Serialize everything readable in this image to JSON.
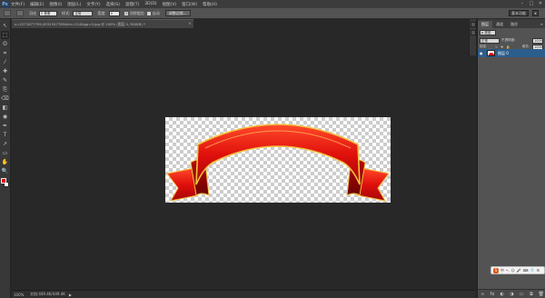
{
  "menubar": {
    "logo": "Ps",
    "items": [
      "文件(F)",
      "编辑(E)",
      "图像(I)",
      "图层(L)",
      "文字(Y)",
      "选择(S)",
      "滤镜(T)",
      "3D(D)",
      "视图(V)",
      "窗口(W)",
      "帮助(H)"
    ],
    "window_buttons": [
      "–",
      "□",
      "✕"
    ]
  },
  "options": {
    "feather_label": "羽化",
    "feather_value": "0 像素",
    "mode_label": "样式:",
    "mode_value": "正常",
    "width_label": "宽度:",
    "width_value": "0",
    "antialias_label": "消除锯齿",
    "antialias_checked": "✓",
    "auto_label": "自动",
    "refine_label": "调整边缘...",
    "workspace": "基本功能"
  },
  "document": {
    "tab_title": "u=2271877799,4531347765&fm=214&gp=0.jpg @ 100% (图层 0, RGB/8) *",
    "close": "×",
    "zoom": "100%",
    "doc_info": "文档:449.4K/449.4K",
    "status_arrow": "▶"
  },
  "tools": [
    "↖",
    "⬚",
    "ʘ",
    "⌗",
    "⁄",
    "✚",
    "✎",
    "⎘",
    "⌫",
    "◧",
    "◉",
    "✒",
    "T",
    "↗",
    "▭",
    "✋",
    "🔍"
  ],
  "panel": {
    "tabs": [
      "图层",
      "通道",
      "路径"
    ],
    "menu": "≡",
    "kind_label": "ρ 类型",
    "blend_mode": "正常",
    "opacity_label": "不透明度:",
    "opacity_value": "100%",
    "lock_label": "锁定:",
    "lock_icons": "⬚ ✎ ✚ 🔒",
    "fill_label": "填充:",
    "fill_value": "100%",
    "layer_name": "图层 0",
    "layer_visible": "●",
    "footer_icons": [
      "∞",
      "fx",
      "◐",
      "◑",
      "▭",
      "⧉",
      "🗑"
    ]
  },
  "ime": {
    "logo": "S",
    "items": [
      "中",
      "•,",
      "☺",
      "🎤",
      "⌨",
      "👕",
      "⚙"
    ]
  },
  "colors": {
    "foreground": "#e00000",
    "background": "#ffffff",
    "selection": "#2c5e8c"
  }
}
